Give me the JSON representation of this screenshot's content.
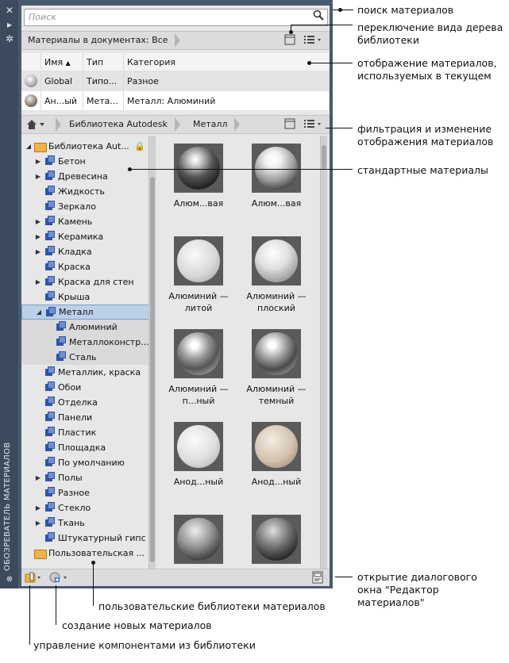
{
  "palette": {
    "title": "ОБОЗРЕВАТЕЛЬ МАТЕРИАЛОВ",
    "close_icon": "✕",
    "autohide_icon": "▸",
    "properties_icon": "✲"
  },
  "search": {
    "placeholder": "Поиск",
    "icon": "search-icon"
  },
  "doc_materials": {
    "breadcrumb": "Материалы в документах: Все",
    "columns": [
      "",
      "Имя",
      "Тип",
      "Категория"
    ],
    "rows": [
      {
        "name": "Global",
        "type": "Типо...",
        "category": "Разное"
      },
      {
        "name": "Ан...ый",
        "type": "Мета...",
        "category": "Металл: Алюминий"
      }
    ]
  },
  "library": {
    "breadcrumbs": [
      "Библиотека Autodesk",
      "Металл"
    ],
    "tree": [
      {
        "label": "Библиотека Aut...",
        "level": 0,
        "kind": "folder",
        "expanded": true
      },
      {
        "label": "Бетон",
        "level": 1,
        "kind": "cat",
        "arrow": true
      },
      {
        "label": "Древесина",
        "level": 1,
        "kind": "cat",
        "arrow": true
      },
      {
        "label": "Жидкость",
        "level": 1,
        "kind": "cat",
        "arrow": false
      },
      {
        "label": "Зеркало",
        "level": 1,
        "kind": "cat",
        "arrow": false
      },
      {
        "label": "Камень",
        "level": 1,
        "kind": "cat",
        "arrow": true
      },
      {
        "label": "Керамика",
        "level": 1,
        "kind": "cat",
        "arrow": true
      },
      {
        "label": "Кладка",
        "level": 1,
        "kind": "cat",
        "arrow": true
      },
      {
        "label": "Краска",
        "level": 1,
        "kind": "cat",
        "arrow": false
      },
      {
        "label": "Краска для стен",
        "level": 1,
        "kind": "cat",
        "arrow": true
      },
      {
        "label": "Крыша",
        "level": 1,
        "kind": "cat",
        "arrow": false
      },
      {
        "label": "Металл",
        "level": 1,
        "kind": "cat",
        "arrow": true,
        "expanded": true,
        "selected": true
      },
      {
        "label": "Алюминий",
        "level": 2,
        "kind": "cat",
        "arrow": false
      },
      {
        "label": "Металлоконстр...",
        "level": 2,
        "kind": "cat",
        "arrow": false
      },
      {
        "label": "Сталь",
        "level": 2,
        "kind": "cat",
        "arrow": false
      },
      {
        "label": "Металлик, краска",
        "level": 1,
        "kind": "cat",
        "arrow": false
      },
      {
        "label": "Обои",
        "level": 1,
        "kind": "cat",
        "arrow": false
      },
      {
        "label": "Отделка",
        "level": 1,
        "kind": "cat",
        "arrow": false
      },
      {
        "label": "Панели",
        "level": 1,
        "kind": "cat",
        "arrow": false
      },
      {
        "label": "Пластик",
        "level": 1,
        "kind": "cat",
        "arrow": false
      },
      {
        "label": "Площадка",
        "level": 1,
        "kind": "cat",
        "arrow": false
      },
      {
        "label": "По умолчанию",
        "level": 1,
        "kind": "cat",
        "arrow": false
      },
      {
        "label": "Полы",
        "level": 1,
        "kind": "cat",
        "arrow": true
      },
      {
        "label": "Разное",
        "level": 1,
        "kind": "cat",
        "arrow": false
      },
      {
        "label": "Стекло",
        "level": 1,
        "kind": "cat",
        "arrow": true
      },
      {
        "label": "Ткань",
        "level": 1,
        "kind": "cat",
        "arrow": true
      },
      {
        "label": "Штукатурный гипс",
        "level": 1,
        "kind": "cat",
        "arrow": false
      },
      {
        "label": "Пользовательская ...",
        "level": 0,
        "kind": "folder",
        "arrow": false
      }
    ],
    "swatches": [
      {
        "caption": "Алюм...вая",
        "tone": "dark-chrome"
      },
      {
        "caption": "Алюм...вая",
        "tone": "bright-chrome"
      },
      {
        "caption": "Алюминий — литой",
        "tone": "matte"
      },
      {
        "caption": "Алюминий — плоский",
        "tone": "satin"
      },
      {
        "caption": "Алюминий — п...ный",
        "tone": "polished"
      },
      {
        "caption": "Алюминий — темный",
        "tone": "polished-dark"
      },
      {
        "caption": "Анод...ный",
        "tone": "matte-light"
      },
      {
        "caption": "Анод...ный",
        "tone": "beige"
      },
      {
        "caption": "",
        "tone": "steel"
      },
      {
        "caption": "",
        "tone": "steel-dark"
      }
    ]
  },
  "annotations": {
    "search": "поиск материалов",
    "tree_view": "переключение вида дерева библиотеки",
    "doc_view": "отображение материалов, используемых в текущем",
    "filter": "фильтрация и изменение отображения материалов",
    "standard": "стандартные материалы",
    "editor": "открытие диалогового окна \"Редактор материалов\"",
    "user_libs": "пользовательские библиотеки материалов",
    "create": "создание новых материалов",
    "manage": "управление компонентами из библиотеки"
  }
}
